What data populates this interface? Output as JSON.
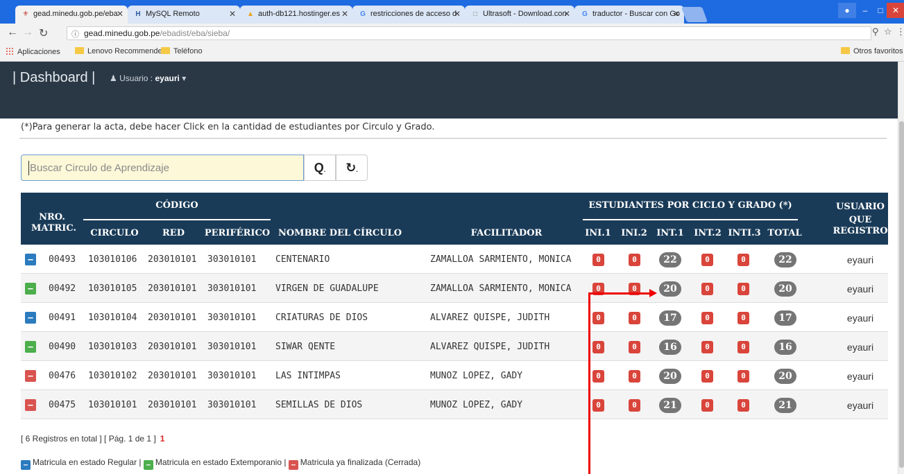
{
  "browser": {
    "tabs": [
      {
        "title": "gead.minedu.gob.pe/eba",
        "icon": "shield",
        "icon_color": "#c0392b"
      },
      {
        "title": "MySQL Remoto",
        "icon": "H",
        "icon_color": "#2c5aa0"
      },
      {
        "title": "auth-db121.hostinger.es",
        "icon": "pma",
        "icon_color": "#e8a21c"
      },
      {
        "title": "restricciones de acceso d",
        "icon": "G",
        "icon_color": "#4285f4"
      },
      {
        "title": "Ultrasoft - Download.con",
        "icon": "doc",
        "icon_color": "#888888"
      },
      {
        "title": "traductor - Buscar con Go",
        "icon": "G",
        "icon_color": "#4285f4"
      }
    ],
    "url_host": "gead.minedu.gob.pe",
    "url_path": "/ebadist/eba/sieba/",
    "bookmarks": [
      "Aplicaciones",
      "Lenovo Recommende",
      "Teléfono"
    ],
    "other_bookmarks": "Otros favoritos"
  },
  "app": {
    "brand": "| Dashboard |",
    "user_label": "Usuario :",
    "user_name": "eyauri",
    "note": "(*)Para generar la acta, debe hacer Click en la cantidad de estudiantes por Circulo y Grado.",
    "search_placeholder": "Buscar Circulo de Aprendizaje"
  },
  "table": {
    "headers": {
      "nro": "NRO.",
      "matric": "MATRIC.",
      "codigo": "CÓDIGO",
      "circulo": "CIRCULO",
      "red": "RED",
      "periferico": "PERIFÉRICO",
      "nombre": "NOMBRE DEL CÍRCULO",
      "facilitador": "FACILITADOR",
      "estudiantes": "ESTUDIANTES POR CICLO Y GRADO (*)",
      "ini1": "INI.1",
      "ini2": "INI.2",
      "int1": "INT.1",
      "int2": "INT.2",
      "inti3": "INTI.3",
      "total": "TOTAL",
      "usuario": "USUARIO",
      "que": "QUE",
      "registro": "REGISTRO"
    },
    "rows": [
      {
        "status": "regular",
        "nro": "00493",
        "circulo": "103010106",
        "red": "203010101",
        "periferico": "303010101",
        "nombre": "CENTENARIO",
        "facilitador": "ZAMALLOA SARMIENTO, MONICA",
        "ini1": "0",
        "ini2": "0",
        "int1": "22",
        "int2": "0",
        "inti3": "0",
        "total": "22",
        "usuario": "eyauri"
      },
      {
        "status": "extemporaneo",
        "nro": "00492",
        "circulo": "103010105",
        "red": "203010101",
        "periferico": "303010101",
        "nombre": "VIRGEN DE GUADALUPE",
        "facilitador": "ZAMALLOA SARMIENTO, MONICA",
        "ini1": "0",
        "ini2": "0",
        "int1": "20",
        "int2": "0",
        "inti3": "0",
        "total": "20",
        "usuario": "eyauri"
      },
      {
        "status": "regular",
        "nro": "00491",
        "circulo": "103010104",
        "red": "203010101",
        "periferico": "303010101",
        "nombre": "CRIATURAS DE DIOS",
        "facilitador": "ALVAREZ QUISPE, JUDITH",
        "ini1": "0",
        "ini2": "0",
        "int1": "17",
        "int2": "0",
        "inti3": "0",
        "total": "17",
        "usuario": "eyauri"
      },
      {
        "status": "extemporaneo",
        "nro": "00490",
        "circulo": "103010103",
        "red": "203010101",
        "periferico": "303010101",
        "nombre": "SIWAR QENTE",
        "facilitador": "ALVAREZ QUISPE, JUDITH",
        "ini1": "0",
        "ini2": "0",
        "int1": "16",
        "int2": "0",
        "inti3": "0",
        "total": "16",
        "usuario": "eyauri"
      },
      {
        "status": "cerrada",
        "nro": "00476",
        "circulo": "103010102",
        "red": "203010101",
        "periferico": "303010101",
        "nombre": "LAS INTIMPAS",
        "facilitador": "MUNOZ LOPEZ, GADY",
        "ini1": "0",
        "ini2": "0",
        "int1": "20",
        "int2": "0",
        "inti3": "0",
        "total": "20",
        "usuario": "eyauri"
      },
      {
        "status": "cerrada",
        "nro": "00475",
        "circulo": "103010101",
        "red": "203010101",
        "periferico": "303010101",
        "nombre": "SEMILLAS DE DIOS",
        "facilitador": "MUNOZ LOPEZ, GADY",
        "ini1": "0",
        "ini2": "0",
        "int1": "21",
        "int2": "0",
        "inti3": "0",
        "total": "21",
        "usuario": "eyauri"
      }
    ]
  },
  "footer": {
    "count_text": "[ 6 Registros en total ]  [ Pág. 1 de 1 ]",
    "page": "1",
    "legend_regular": "Matricula en estado Regular |",
    "legend_extemporaneo": "Matricula en estado Extemporanio |",
    "legend_cerrada": "Matricula ya finalizada (Cerrada)"
  },
  "colors": {
    "regular": "#2b7bbf",
    "extemporaneo": "#4cae4c",
    "cerrada": "#d9534f",
    "navbar": "#2a3846",
    "table_header": "#1a3b58"
  }
}
